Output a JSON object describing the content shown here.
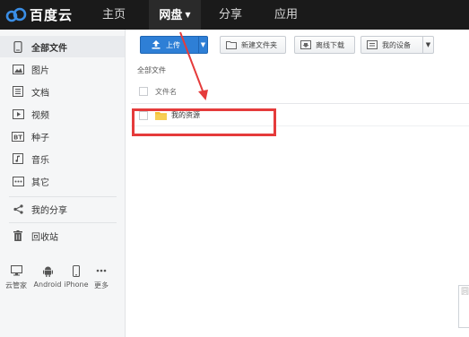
{
  "app": {
    "logo_text": "百度云"
  },
  "topnav": {
    "items": [
      {
        "label": "主页"
      },
      {
        "label": "网盘",
        "active": true
      },
      {
        "label": "分享"
      },
      {
        "label": "应用"
      }
    ]
  },
  "sidebar": {
    "items": [
      {
        "label": "全部文件",
        "icon": "phone-icon",
        "active": true
      },
      {
        "label": "图片",
        "icon": "image-icon"
      },
      {
        "label": "文档",
        "icon": "document-icon"
      },
      {
        "label": "视频",
        "icon": "video-icon"
      },
      {
        "label": "种子",
        "icon": "torrent-icon"
      },
      {
        "label": "音乐",
        "icon": "music-icon"
      },
      {
        "label": "其它",
        "icon": "more-icon"
      }
    ],
    "share": {
      "label": "我的分享",
      "icon": "share-icon"
    },
    "recycle": {
      "label": "回收站",
      "icon": "trash-icon"
    },
    "devices": [
      {
        "label": "云管家",
        "icon": "monitor-icon"
      },
      {
        "label": "Android",
        "icon": "android-icon"
      },
      {
        "label": "iPhone",
        "icon": "iphone-icon"
      },
      {
        "label": "更多",
        "icon": "ellipsis-icon"
      }
    ]
  },
  "toolbar": {
    "upload_label": "上传",
    "new_folder_label": "新建文件夹",
    "offline_download_label": "离线下载",
    "my_devices_label": "我的设备"
  },
  "breadcrumb": "全部文件",
  "file_list": {
    "column_name": "文件名",
    "rows": [
      {
        "name": "我的资源"
      }
    ]
  },
  "watermark": "圆",
  "colors": {
    "topbar": "#1a1a1a",
    "accent": "#2e7fd6",
    "annotation": "#e53b3b",
    "folder": "#f4c036"
  }
}
